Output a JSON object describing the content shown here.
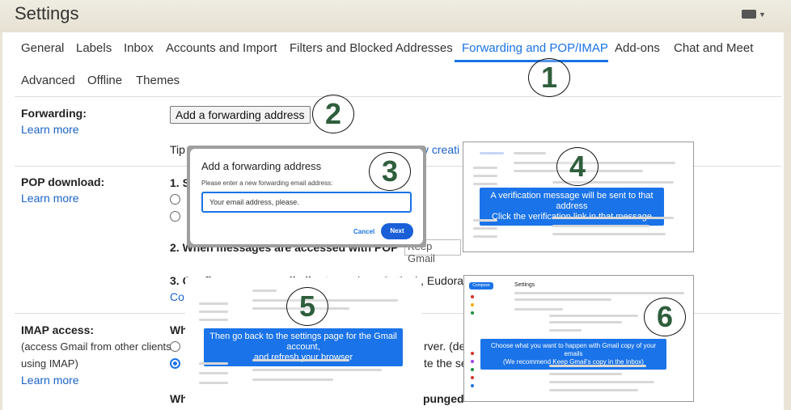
{
  "window": {
    "title": "Settings"
  },
  "tabs": [
    {
      "label": "General"
    },
    {
      "label": "Labels"
    },
    {
      "label": "Inbox"
    },
    {
      "label": "Accounts and Import"
    },
    {
      "label": "Filters and Blocked Addresses"
    },
    {
      "label": "Forwarding and POP/IMAP"
    },
    {
      "label": "Add-ons"
    },
    {
      "label": "Chat and Meet"
    },
    {
      "label": "Advanced"
    },
    {
      "label": "Offline"
    },
    {
      "label": "Themes"
    }
  ],
  "forwarding": {
    "label": "Forwarding:",
    "learn_more": "Learn more",
    "add_button": "Add a forwarding address",
    "tip": "Tip",
    "tip_end": "y creati"
  },
  "pop": {
    "label": "POP download:",
    "learn_more": "Learn more",
    "step1": "1. S",
    "step2": "2. When messages are accessed with POP",
    "step2_select": "Keep Gmail",
    "step3": "3. Configure your email client",
    "step3_end": "(e.g. Outlook, Eudora, Ne",
    "step3_link": "Co"
  },
  "imap": {
    "label": "IMAP access:",
    "desc1": "(access Gmail from other clients",
    "desc2": "using IMAP)",
    "learn_more": "Learn more",
    "status": "Wh",
    "line1_end": "rver. (de",
    "line2_end": "te the se",
    "bottom": "Wh",
    "bottom_end": "punged"
  },
  "dialog": {
    "title": "Add a forwarding address",
    "subtitle": "Please enter a new forwarding email address:",
    "input_value": "Your email address, please.",
    "cancel": "Cancel",
    "next": "Next"
  },
  "callouts": [
    {
      "number": "1"
    },
    {
      "number": "2"
    },
    {
      "number": "3"
    },
    {
      "number": "4"
    },
    {
      "number": "5"
    },
    {
      "number": "6"
    }
  ],
  "shot4": {
    "line1": "A verification message will be sent to that address",
    "line2": "Click the verification link in that message"
  },
  "shot5": {
    "line1": "Then go back to the settings page for the Gmail account,",
    "line2": "and refresh your browser"
  },
  "shot6": {
    "line1": "Choose what you want to happen with Gmail copy of your emails",
    "line2": "(We recommend Keep Gmail's copy in the Inbox)",
    "header": "Settings",
    "compose": "Compose"
  },
  "colors": {
    "accent": "#1a73e8",
    "callout_text": "#2e5e3c"
  }
}
